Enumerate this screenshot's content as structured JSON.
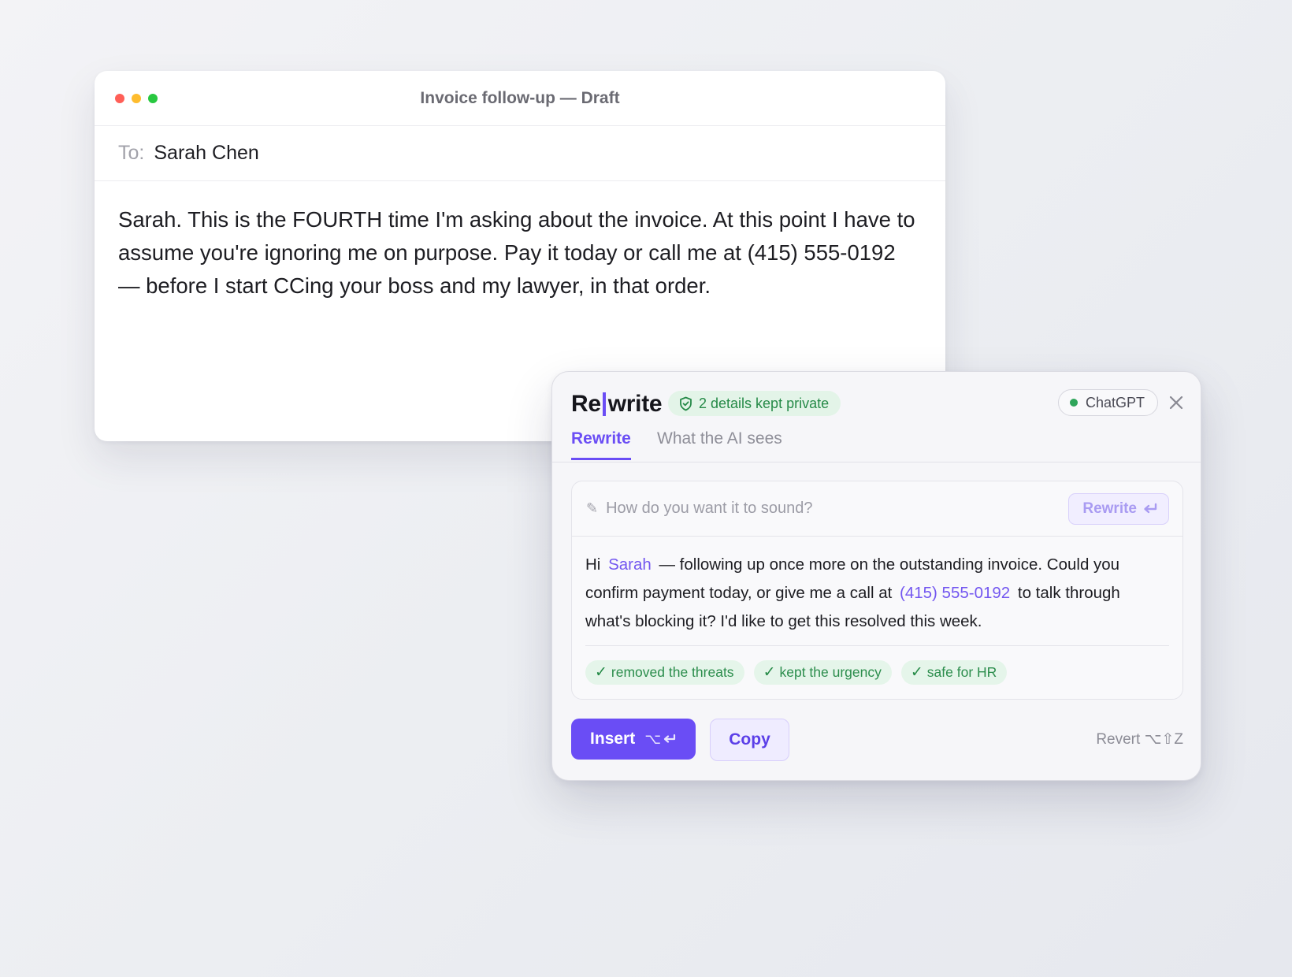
{
  "mail": {
    "title": "Invoice follow-up — Draft",
    "to_label": "To:",
    "to_value": "Sarah Chen",
    "body": "Sarah. This is the FOURTH time I'm asking about the invoice. At this point I have to assume you're ignoring me on purpose. Pay it today or call me at (415) 555-0192 — before I start CCing your boss and my lawyer, in that order.",
    "traffic_colors": [
      "#ff5f57",
      "#febc2e",
      "#28c840"
    ]
  },
  "panel": {
    "brand_left": "Re",
    "brand_right": "write",
    "private_badge": "2 details kept private",
    "model": "ChatGPT",
    "close_icon": "close-icon",
    "tabs": [
      {
        "label": "Rewrite",
        "active": true
      },
      {
        "label": "What the AI sees",
        "active": false
      }
    ],
    "prompt_placeholder": "How do you want it to sound?",
    "rewrite_button": "Rewrite",
    "suggestion": {
      "part1": "Hi ",
      "token_name": "Sarah",
      "part2": " — following up once more on the outstanding invoice. Could you confirm payment today, or give me a call at ",
      "token_phone": "(415) 555-0192",
      "part3": " to talk through what's blocking it? I'd like to get this resolved this week."
    },
    "chips": [
      "removed the threats",
      "kept the urgency",
      "safe for HR"
    ],
    "insert_label": "Insert",
    "insert_shortcut": "⌥",
    "copy_label": "Copy",
    "revert_label": "Revert ⌥⇧Z"
  },
  "colors": {
    "accent": "#6a4df5",
    "success": "#2b8d4c",
    "success_bg": "#e5f5ea"
  }
}
